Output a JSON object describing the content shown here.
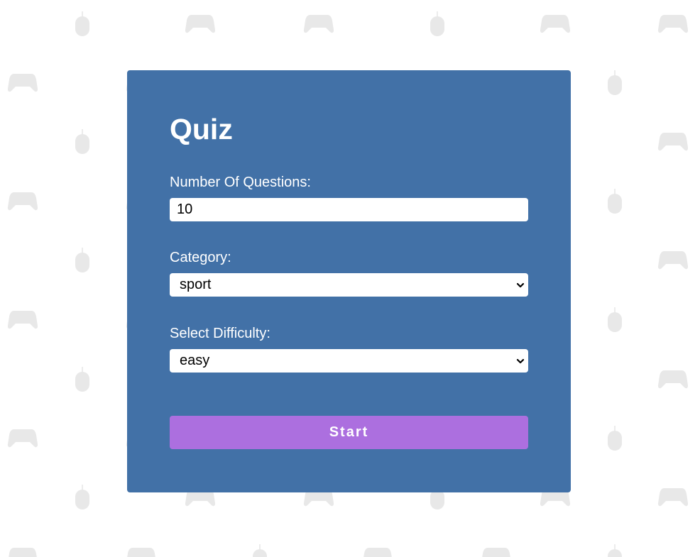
{
  "colors": {
    "card_background": "#4271a7",
    "start_button": "#ac6fdf",
    "pattern_icon": "#e8e8e8",
    "page_background": "#ffffff"
  },
  "background_pattern": {
    "icons": [
      "gamepad-icon",
      "mouse-icon"
    ]
  },
  "quiz": {
    "title": "Quiz",
    "questions": {
      "label": "Number Of Questions:",
      "value": "10"
    },
    "category": {
      "label": "Category:",
      "selected": "sport"
    },
    "difficulty": {
      "label": "Select Difficulty:",
      "selected": "easy"
    },
    "start_label": "Start"
  }
}
